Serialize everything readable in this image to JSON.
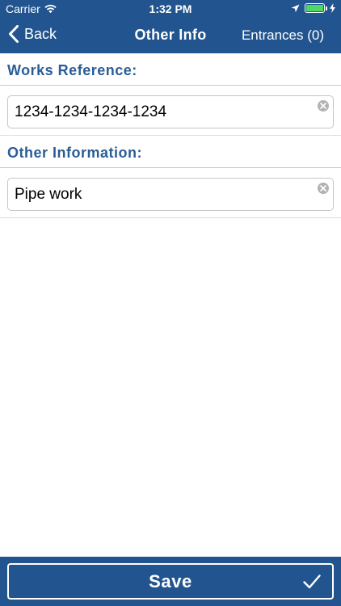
{
  "status_bar": {
    "carrier": "Carrier",
    "time": "1:32 PM",
    "icons": [
      "wifi-icon",
      "location-icon",
      "battery-icon",
      "charging-icon"
    ]
  },
  "nav": {
    "back_label": "Back",
    "title": "Other Info",
    "right_label": "Entrances (0)"
  },
  "form": {
    "works_reference": {
      "label": "Works Reference:",
      "value": "1234-1234-1234-1234"
    },
    "other_information": {
      "label": "Other Information:",
      "value": "Pipe work"
    }
  },
  "footer": {
    "save_label": "Save"
  },
  "colors": {
    "brand": "#22558f",
    "section_label": "#2a5d96",
    "battery": "#4cd964"
  }
}
